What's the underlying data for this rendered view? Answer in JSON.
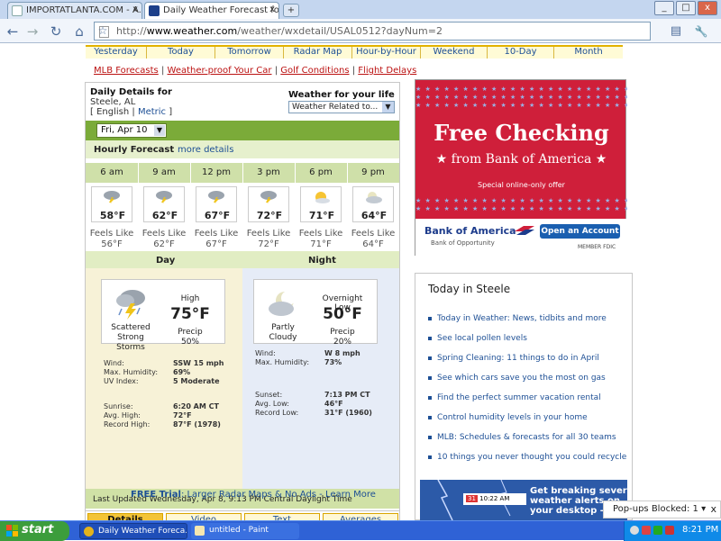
{
  "browser": {
    "tabs": [
      {
        "title": "IMPORTATLANTA.COM - A...",
        "close": "x"
      },
      {
        "title": "Daily Weather Forecast for...",
        "close": "x"
      }
    ],
    "new_tab": "+",
    "window_buttons": [
      "_",
      "□",
      "x"
    ],
    "url": {
      "scheme": "http://",
      "host": "www.weather.com",
      "path": "/weather/wxdetail/USAL0512?dayNum=2"
    },
    "nav_glyphs": {
      "back": "←",
      "forward": "→",
      "reload": "↻",
      "home": "⌂",
      "star": "☆",
      "page": "▤",
      "tools": "🔧"
    }
  },
  "site": {
    "nav_tabs": [
      "Yesterday",
      "Today",
      "Tomorrow",
      "Radar Map",
      "Hour-by-Hour",
      "Weekend",
      "10-Day",
      "Month"
    ],
    "links": [
      "MLB Forecasts",
      "Weather-proof Your Car",
      "Golf Conditions",
      "Flight Delays"
    ],
    "link_sep": "|"
  },
  "detail": {
    "heading": "Daily Details for",
    "location": "Steele, AL",
    "units_open": "[",
    "unit_english": "English",
    "unit_sep": "|",
    "unit_metric": "Metric",
    "units_close": "]",
    "wfl_label": "Weather for your life",
    "wfl_select": "Weather Related to...",
    "date_select": "Fri, Apr 10",
    "hourly_title": "Hourly Forecast",
    "more_details": "more details",
    "feels_like_label": "Feels Like",
    "hours": [
      {
        "time": "6 am",
        "icon": "thunderstorm-icon",
        "temp": "58°F",
        "feels": "56°F"
      },
      {
        "time": "9 am",
        "icon": "thunderstorm-icon",
        "temp": "62°F",
        "feels": "62°F"
      },
      {
        "time": "12 pm",
        "icon": "thunderstorm-icon",
        "temp": "67°F",
        "feels": "67°F"
      },
      {
        "time": "3 pm",
        "icon": "thunderstorm-icon",
        "temp": "72°F",
        "feels": "72°F"
      },
      {
        "time": "6 pm",
        "icon": "partly-sunny-icon",
        "temp": "71°F",
        "feels": "71°F"
      },
      {
        "time": "9 pm",
        "icon": "partly-cloudy-night-icon",
        "temp": "64°F",
        "feels": "64°F"
      }
    ],
    "day": {
      "label": "Day",
      "condition": "Scattered Strong Storms",
      "hl_label": "High",
      "temp": "75°F",
      "precip_label": "Precip",
      "precip": "50%",
      "stats": [
        {
          "k": "Wind:",
          "v": "SSW 15 mph"
        },
        {
          "k": "Max. Humidity:",
          "v": "69%"
        },
        {
          "k": "UV Index:",
          "v": "5 Moderate"
        }
      ],
      "sun": [
        {
          "k": "Sunrise:",
          "v": "6:20 AM CT"
        },
        {
          "k": "Avg. High:",
          "v": "72°F"
        },
        {
          "k": "Record High:",
          "v": "87°F (1978)"
        }
      ]
    },
    "night": {
      "label": "Night",
      "condition": "Partly Cloudy",
      "hl_label": "Overnight Low",
      "temp": "50°F",
      "precip_label": "Precip",
      "precip": "20%",
      "stats": [
        {
          "k": "Wind:",
          "v": "W 8 mph"
        },
        {
          "k": "Max. Humidity:",
          "v": "73%"
        }
      ],
      "sun": [
        {
          "k": "Sunset:",
          "v": "7:13 PM CT"
        },
        {
          "k": "Avg. Low:",
          "v": "46°F"
        },
        {
          "k": "Record Low:",
          "v": "31°F (1960)"
        }
      ]
    },
    "last_updated": "Last Updated Wednesday, Apr 8, 9:13 PM Central Daylight Time",
    "bottom_tabs": [
      "Details",
      "Video",
      "Text",
      "Averages"
    ],
    "free_trial": {
      "bold": "FREE Trial",
      "rest": ": Larger Radar Maps & No Ads - Learn More"
    }
  },
  "ad": {
    "stars": "★ ★ ★ ★ ★ ★ ★ ★ ★ ★ ★ ★ ★ ★ ★ ★ ★ ★ ★ ★ ★ ★ ★ ★ ★",
    "headline": "Free Checking",
    "sub": "★ from Bank of America ★",
    "offer": "Special online-only offer",
    "bank": "Bank of America",
    "tagline": "Bank of Opportunity",
    "button": "Open an Account",
    "fdic": "MEMBER FDIC"
  },
  "today": {
    "title": "Today in Steele",
    "items": [
      "Today in Weather: News, tidbits and more",
      "See local pollen levels",
      "Spring Cleaning: 11 things to do in April",
      "See which cars save you the most on gas",
      "Find the perfect summer vacation rental",
      "Control humidity levels in your home",
      "MLB: Schedules & forecasts for all 30 teams",
      "10 things you never thought you could recycle"
    ]
  },
  "alert_ad": {
    "line1": "Get breaking severe",
    "line2": "weather alerts on",
    "line3": "your desktop - F",
    "clock_day": "31",
    "clock_time": "10:22 AM"
  },
  "popup": {
    "text": "Pop-ups Blocked: 1 ▾",
    "close": "x"
  },
  "taskbar": {
    "start": "start",
    "tasks": [
      "Daily Weather Foreca...",
      "untitled - Paint"
    ],
    "time": "8:21 PM"
  },
  "colors": {
    "green_bar": "#7bab39",
    "accent_link": "#1d4f95",
    "ad_red": "#cf1f3a",
    "taskbar": "#2f62d6"
  }
}
